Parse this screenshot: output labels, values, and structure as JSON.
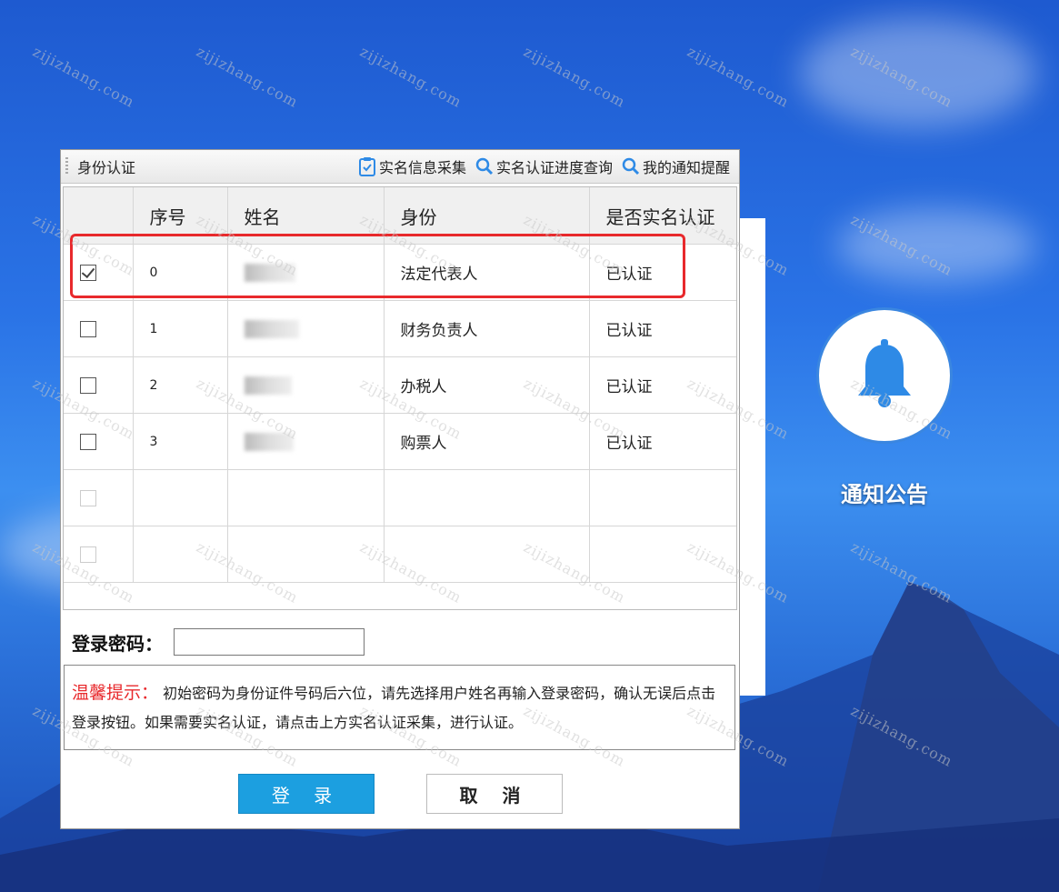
{
  "dialog": {
    "title": "身份认证",
    "tools": [
      {
        "label": "实名信息采集",
        "icon": "clipboard-icon"
      },
      {
        "label": "实名认证进度查询",
        "icon": "search-icon"
      },
      {
        "label": "我的通知提醒",
        "icon": "search-icon"
      }
    ]
  },
  "table": {
    "headers": [
      "序号",
      "姓名",
      "身份",
      "是否实名认证"
    ],
    "rows": [
      {
        "index": "0",
        "role": "法定代表人",
        "status": "已认证",
        "checked": true
      },
      {
        "index": "1",
        "role": "财务负责人",
        "status": "已认证",
        "checked": false
      },
      {
        "index": "2",
        "role": "办税人",
        "status": "已认证",
        "checked": false
      },
      {
        "index": "3",
        "role": "购票人",
        "status": "已认证",
        "checked": false
      }
    ]
  },
  "password": {
    "label": "登录密码：",
    "value": ""
  },
  "tip": {
    "label": "温馨提示：",
    "text": "初始密码为身份证件号码后六位，请先选择用户姓名再输入登录密码，确认无误后点击登录按钮。如果需要实名认证，请点击上方实名认证采集，进行认证。"
  },
  "buttons": {
    "login": "登 录",
    "cancel": "取 消"
  },
  "notice": {
    "label": "通知公告",
    "icon": "bell-icon"
  },
  "watermark": "zijizhang.com",
  "colors": {
    "accent": "#1c9fe0",
    "highlight": "#e8292c",
    "tip_label": "#e8292c"
  }
}
